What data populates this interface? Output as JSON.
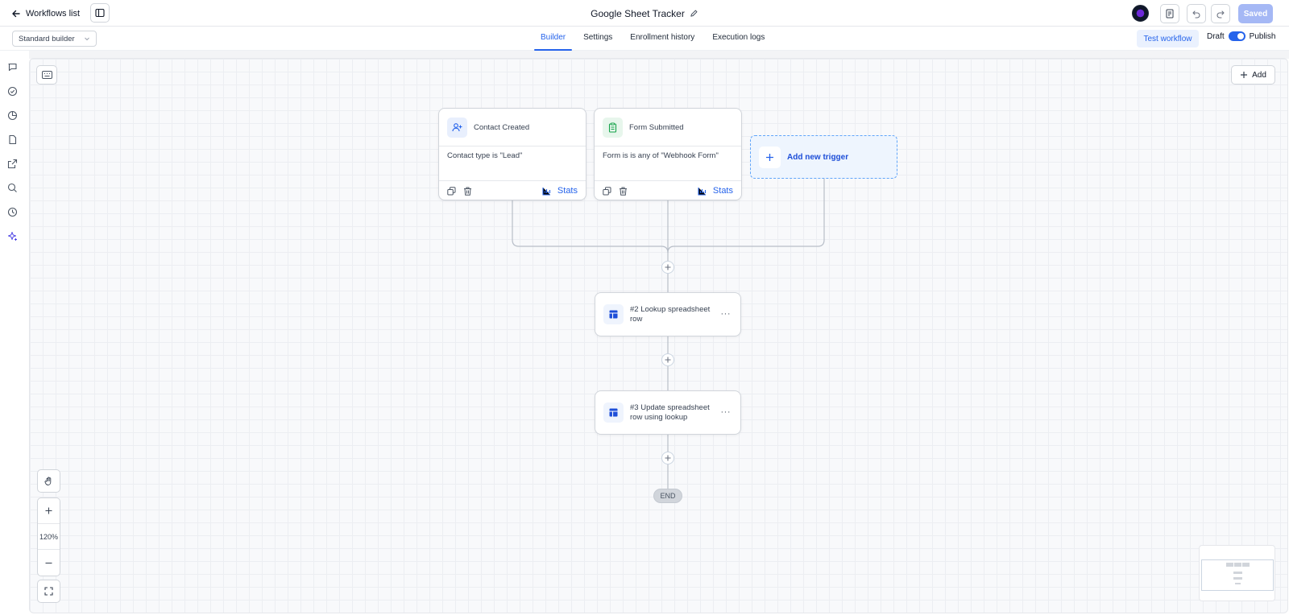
{
  "topbar": {
    "back_label": "Workflows list",
    "workflow_title": "Google Sheet Tracker",
    "saved_label": "Saved"
  },
  "subbar": {
    "builder_mode": "Standard builder",
    "tabs": [
      {
        "label": "Builder",
        "active": true
      },
      {
        "label": "Settings",
        "active": false
      },
      {
        "label": "Enrollment history",
        "active": false
      },
      {
        "label": "Execution logs",
        "active": false
      }
    ],
    "test_label": "Test workflow",
    "draft_label": "Draft",
    "publish_label": "Publish",
    "published": true
  },
  "rail_icons": [
    "chat-icon",
    "check-circle-icon",
    "pie-chart-icon",
    "document-icon",
    "external-link-icon",
    "search-icon",
    "history-icon",
    "sparkle-icon"
  ],
  "canvas": {
    "add_label": "Add",
    "triggers": [
      {
        "name": "Contact Created",
        "condition": "Contact type is \"Lead\"",
        "stats_label": "Stats",
        "icon": "user-plus-icon"
      },
      {
        "name": "Form Submitted",
        "condition": "Form is is any of \"Webhook Form\"",
        "stats_label": "Stats",
        "icon": "clipboard-icon"
      }
    ],
    "new_trigger_label": "Add new trigger",
    "actions": [
      {
        "name": "#2 Lookup spreadsheet row",
        "icon": "spreadsheet-icon"
      },
      {
        "name": "#3 Update spreadsheet row using lookup",
        "icon": "spreadsheet-icon"
      }
    ],
    "end_label": "END",
    "zoom_label": "120%"
  },
  "colors": {
    "accent": "#2563eb",
    "saved_button": "#a5b8f5",
    "trigger_green": "#16a34a"
  }
}
